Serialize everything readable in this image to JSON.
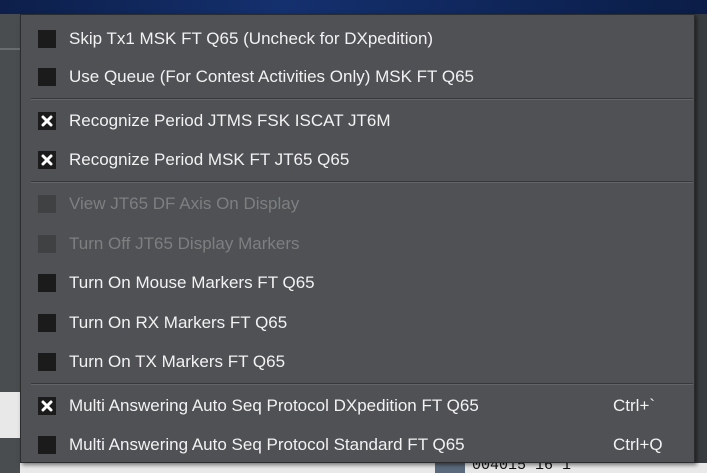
{
  "menu": {
    "items": [
      {
        "label": "Skip Tx1 MSK FT Q65 (Uncheck for DXpedition)",
        "checked": false,
        "enabled": true,
        "shortcut": ""
      },
      {
        "label": "Use Queue (For Contest Activities Only) MSK FT Q65",
        "checked": false,
        "enabled": true,
        "shortcut": ""
      },
      {
        "label": "Recognize Period JTMS FSK ISCAT JT6M",
        "checked": true,
        "enabled": true,
        "shortcut": ""
      },
      {
        "label": "Recognize Period MSK FT JT65 Q65",
        "checked": true,
        "enabled": true,
        "shortcut": ""
      },
      {
        "label": "View JT65 DF Axis On Display",
        "checked": false,
        "enabled": false,
        "shortcut": ""
      },
      {
        "label": "Turn Off JT65 Display Markers",
        "checked": false,
        "enabled": false,
        "shortcut": ""
      },
      {
        "label": "Turn On Mouse Markers FT Q65",
        "checked": false,
        "enabled": true,
        "shortcut": ""
      },
      {
        "label": "Turn On RX Markers FT Q65",
        "checked": false,
        "enabled": true,
        "shortcut": ""
      },
      {
        "label": "Turn On TX Markers FT Q65",
        "checked": false,
        "enabled": true,
        "shortcut": ""
      },
      {
        "label": "Multi Answering Auto Seq Protocol DXpedition FT Q65",
        "checked": true,
        "enabled": true,
        "shortcut": "Ctrl+`"
      },
      {
        "label": "Multi Answering Auto Seq Protocol Standard FT Q65",
        "checked": false,
        "enabled": true,
        "shortcut": "Ctrl+Q"
      }
    ]
  },
  "background": {
    "status_text": "004015   16   1"
  },
  "colors": {
    "menu_bg": "#4f5154",
    "checkbox_bg": "#1b1b1c",
    "text": "#f2f2f2",
    "disabled_text": "#7d7f81"
  }
}
